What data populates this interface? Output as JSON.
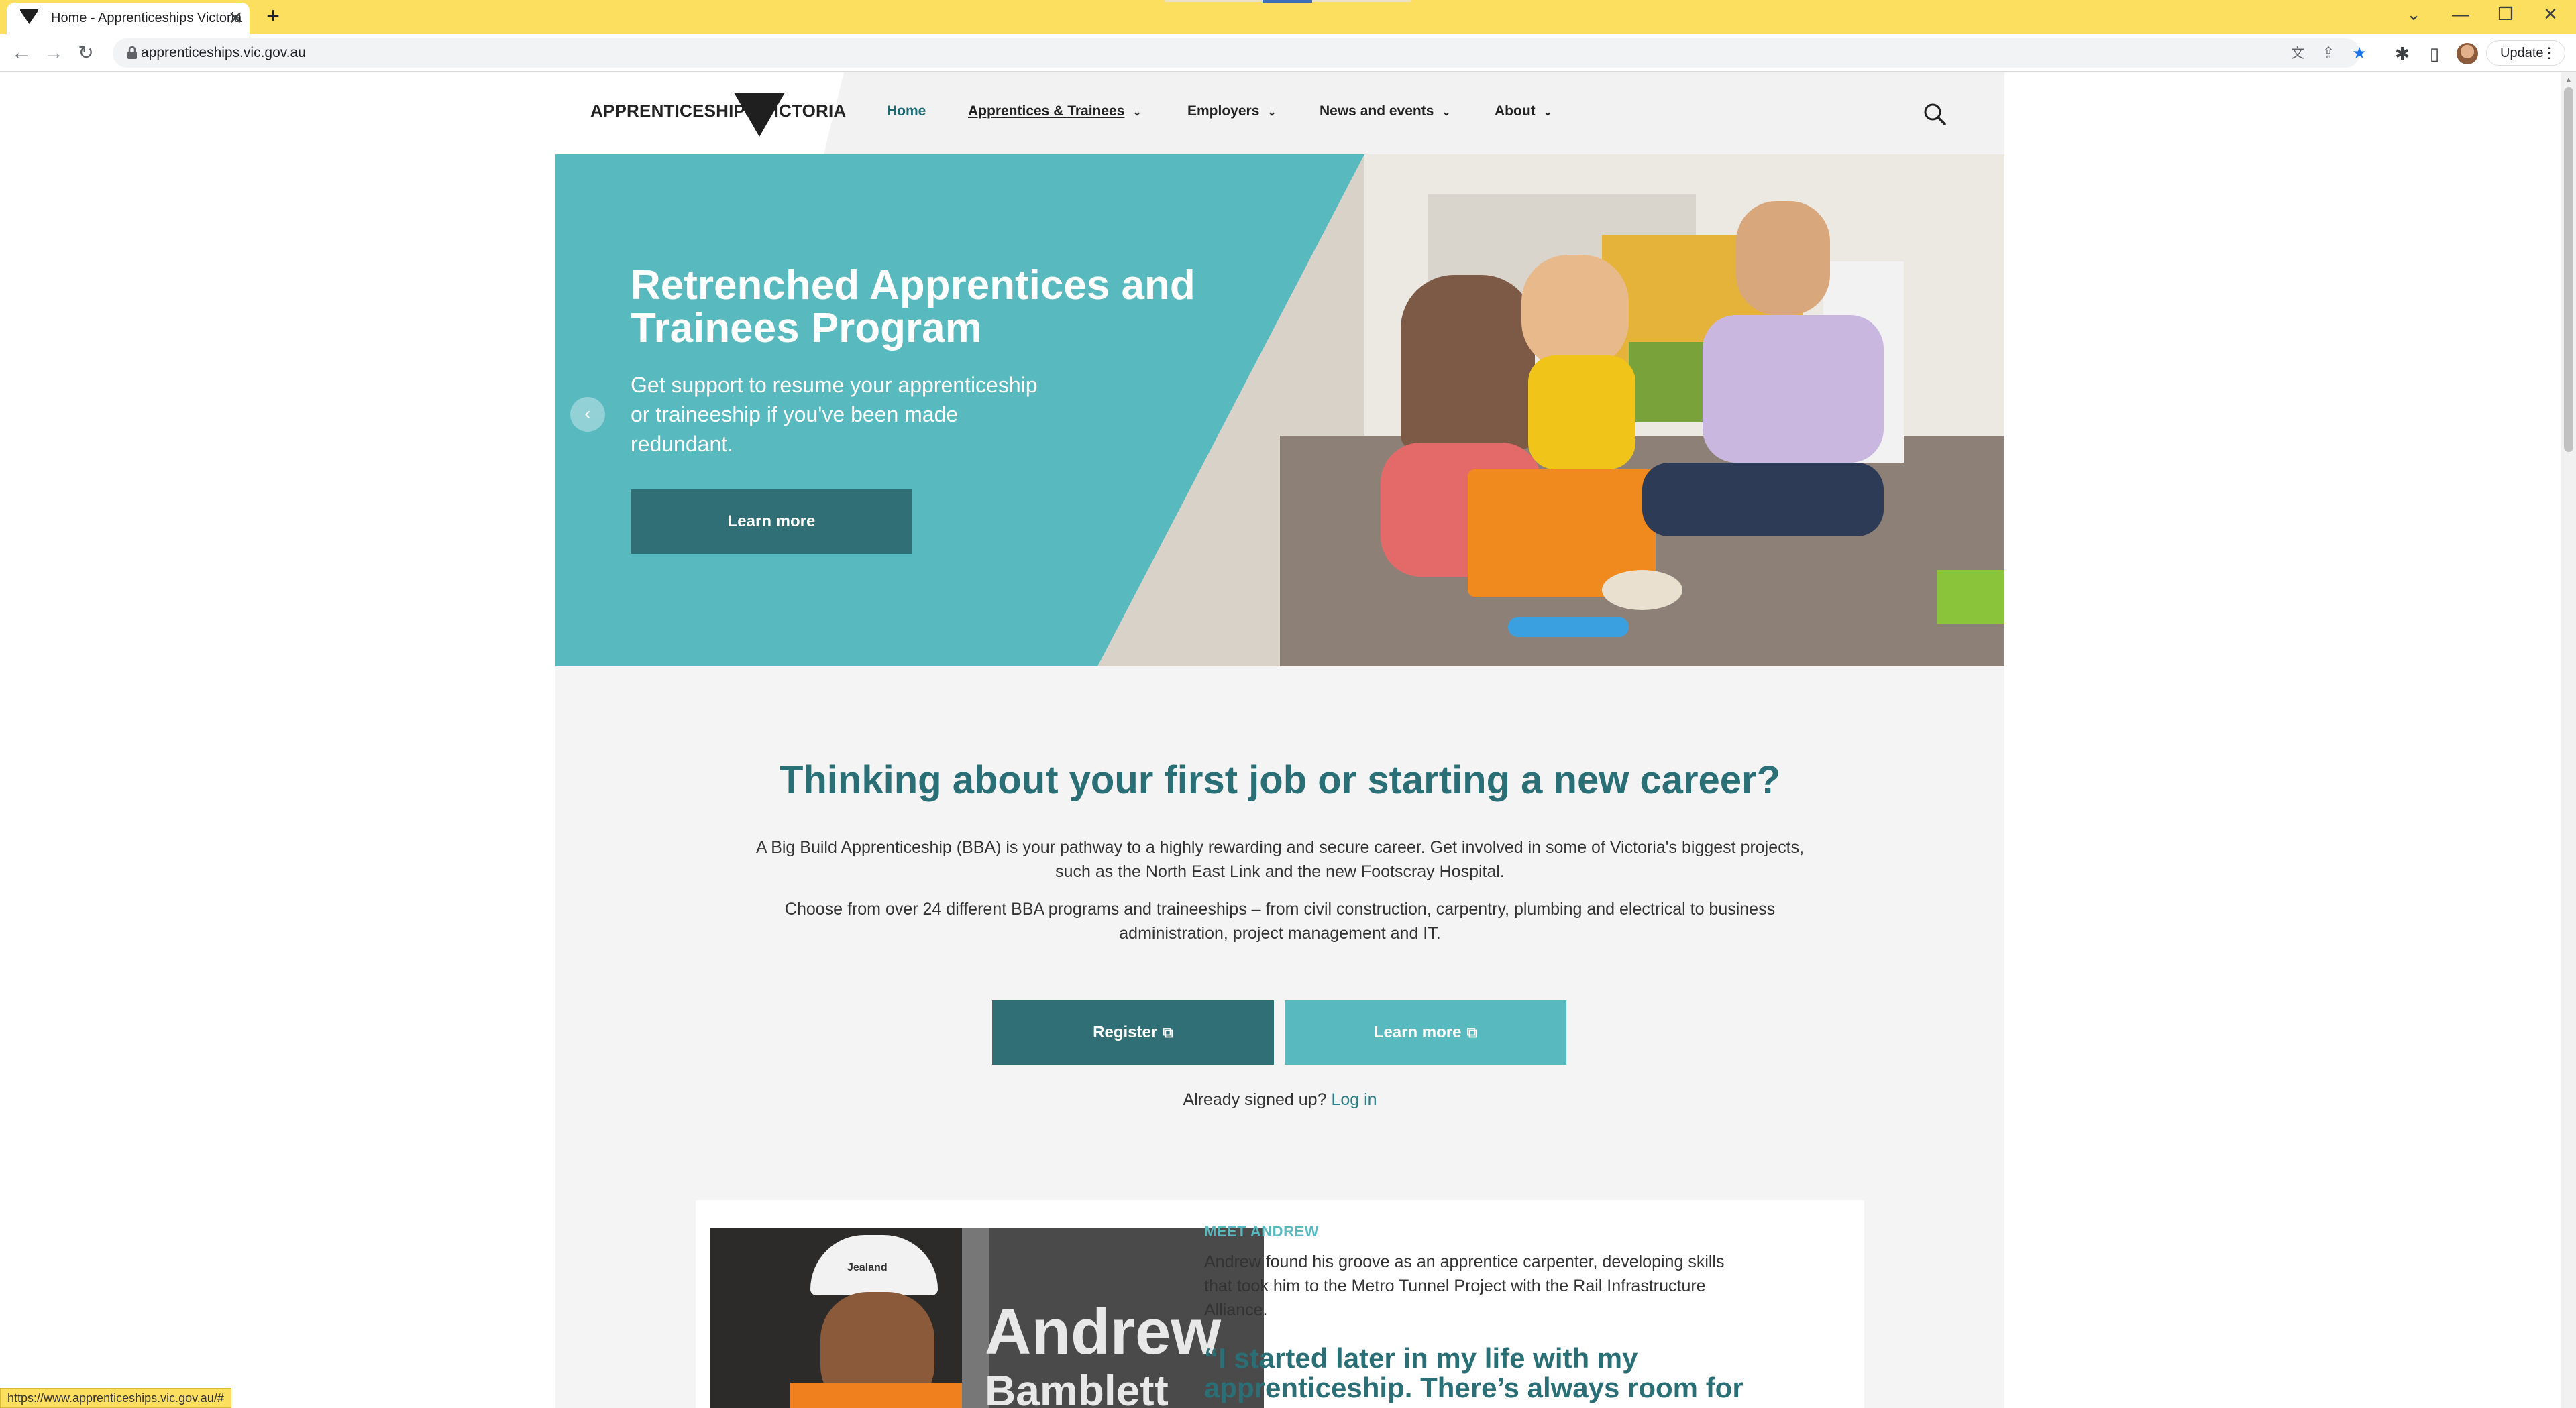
{
  "browser": {
    "tab_title": "Home - Apprenticeships Victoria",
    "tab_close": "✕",
    "new_tab": "+",
    "url": "apprenticeships.vic.gov.au",
    "update_label": "Update",
    "status_url": "https://www.apprenticeships.vic.gov.au/#",
    "window_controls": {
      "minimize": "—",
      "restore": "❐",
      "close": "✕",
      "tablist": "⌄"
    },
    "icons": [
      "back-icon",
      "forward-icon",
      "reload-icon",
      "lock-icon",
      "translate-icon",
      "share-icon",
      "bookmark-star-icon",
      "extensions-icon",
      "side-panel-icon",
      "profile-avatar",
      "menu-icon"
    ],
    "colors": {
      "tabstrip": "#fddf5f",
      "star": "#1a73e8"
    }
  },
  "header": {
    "logo_text": "APPRENTICESHIPS VICTORIA",
    "nav": [
      {
        "label": "Home",
        "has_dropdown": false
      },
      {
        "label": "Apprentices & Trainees",
        "has_dropdown": true
      },
      {
        "label": "Employers",
        "has_dropdown": true
      },
      {
        "label": "News and events",
        "has_dropdown": true
      },
      {
        "label": "About",
        "has_dropdown": true
      }
    ],
    "chevron": "⌄"
  },
  "hero": {
    "title": "Retrenched Apprentices and Trainees Program",
    "subtitle": "Get support to resume your apprenticeship or traineeship if you've been made redundant.",
    "button": "Learn more",
    "prev_arrow": "‹"
  },
  "intro": {
    "title": "Thinking about your first job or starting a new career?",
    "paragraph1": "A Big Build Apprenticeship (BBA) is your pathway to a highly rewarding and secure career. Get involved in some of Victoria's biggest projects, such as the North East Link and the new Footscray Hospital.",
    "paragraph2": "Choose from over 24 different BBA programs and traineeships – from civil construction, carpentry, plumbing and electrical to business administration, project management and IT.",
    "register_button": "Register",
    "learn_button": "Learn more",
    "external_icon": "⧉",
    "signed_up_text": "Already signed up?",
    "login_link": "Log in"
  },
  "story": {
    "label": "MEET ANDREW",
    "text": "Andrew found his groove as an apprentice carpenter, developing skills that took him to the Metro Tunnel Project with the Rail Infrastructure Alliance.",
    "quote": "“I started later in my life with my apprenticeship. There’s always room for",
    "photo_name_first": "Andrew",
    "photo_name_last": "Bamblett",
    "helmet_text": "Jealand"
  },
  "colors": {
    "teal_dark": "#2f6f75",
    "teal_light": "#58b9bf",
    "heading": "#2b6f76"
  }
}
